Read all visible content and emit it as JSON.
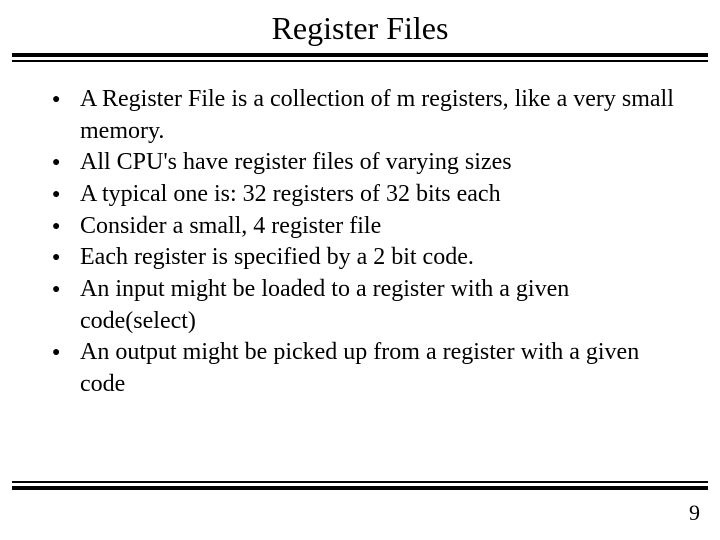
{
  "slide": {
    "title": "Register Files",
    "bullets": [
      "A Register File is a collection of m registers, like a very small memory.",
      "All CPU's have register files of varying sizes",
      "A typical one is: 32 registers of 32 bits each",
      "Consider a small,  4 register file",
      "Each register is specified by a 2 bit code.",
      "An input might be loaded to a register with a given code(select)",
      "An output might be picked up from a register with a given code"
    ],
    "page_number": "9"
  }
}
